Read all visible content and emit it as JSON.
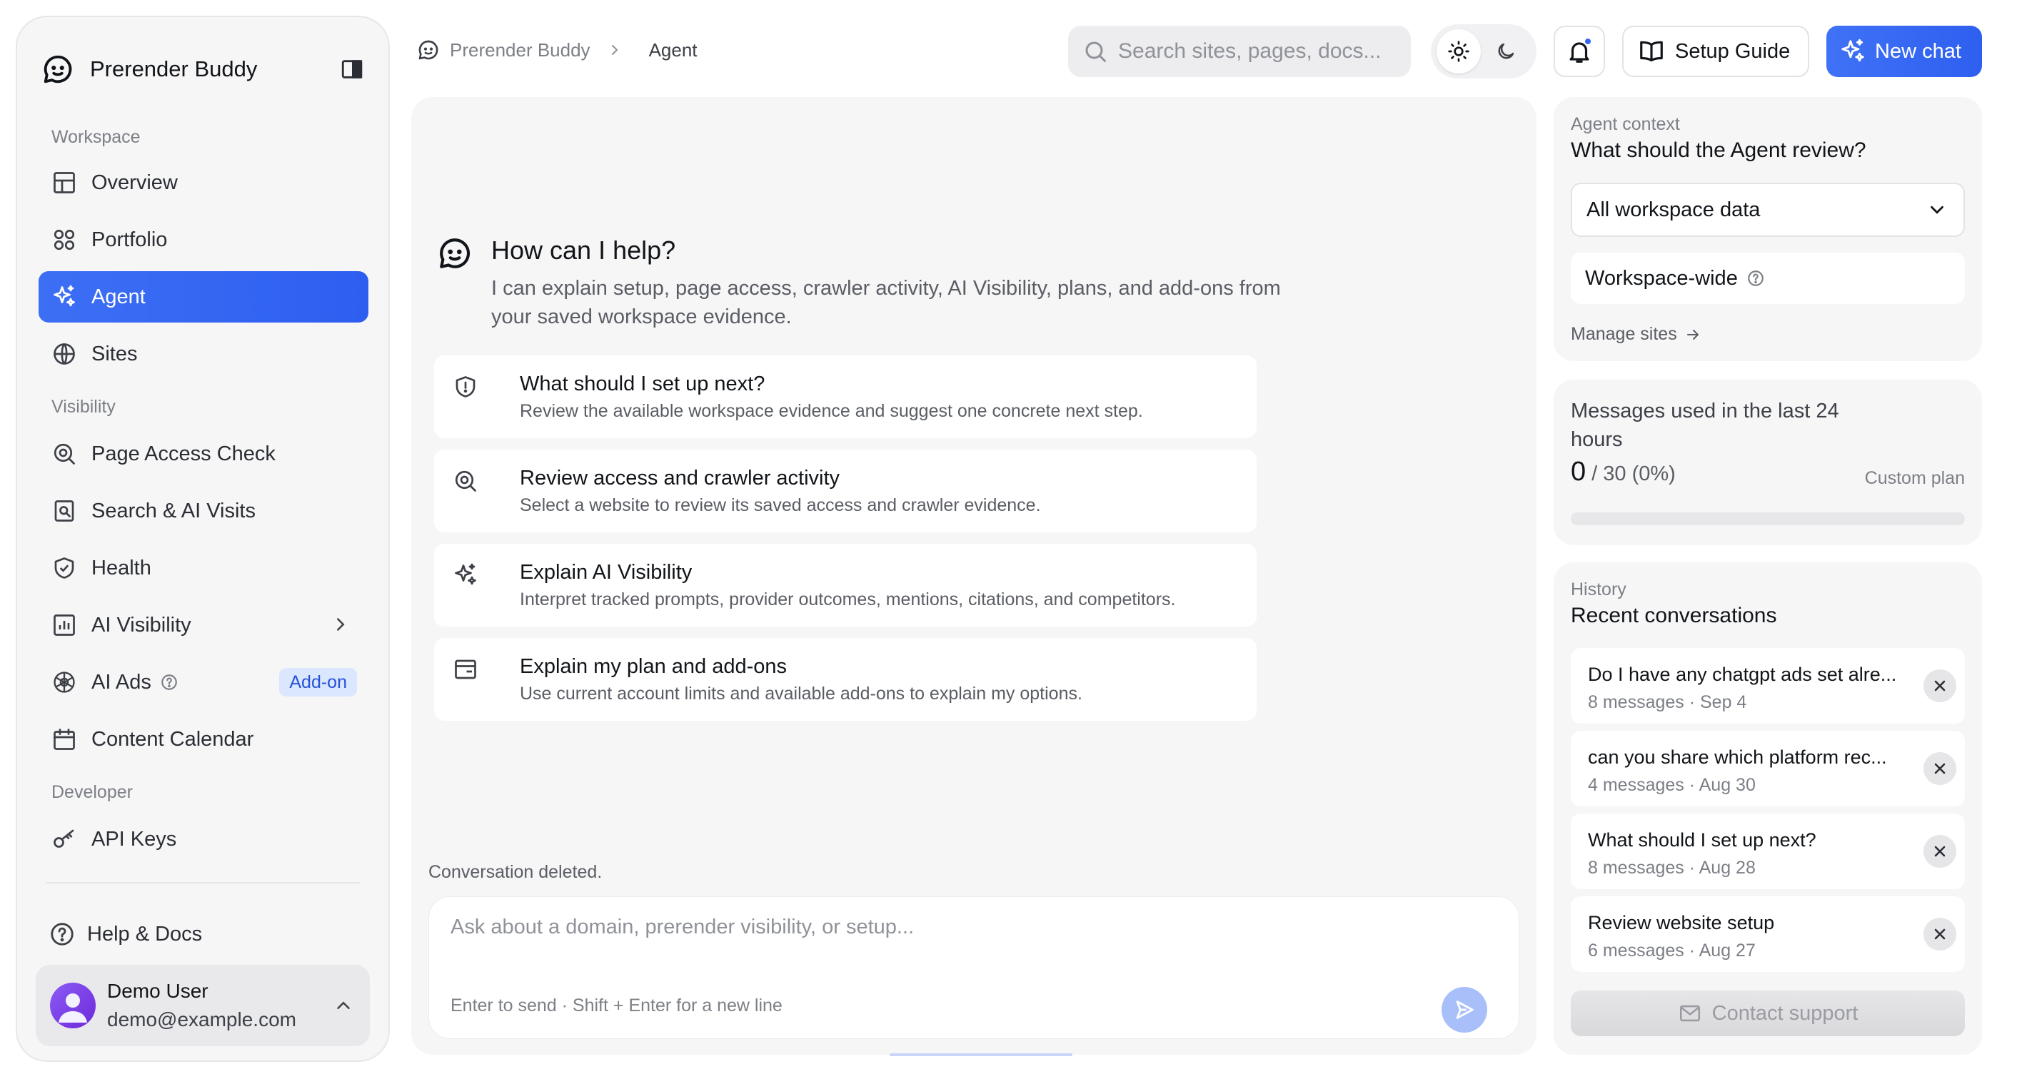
{
  "brand": {
    "name": "Prerender Buddy"
  },
  "sidebar": {
    "sections": {
      "workspace": "Workspace",
      "visibility": "Visibility",
      "developer": "Developer"
    },
    "items": [
      {
        "label": "Overview",
        "icon": "grid-icon"
      },
      {
        "label": "Portfolio",
        "icon": "circles-icon"
      },
      {
        "label": "Agent",
        "icon": "sparkles-icon",
        "active": true
      },
      {
        "label": "Sites",
        "icon": "globe-icon"
      },
      {
        "label": "Page Access Check",
        "icon": "search-scan-icon"
      },
      {
        "label": "Search & AI Visits",
        "icon": "doc-search-icon"
      },
      {
        "label": "Health",
        "icon": "shield-check-icon"
      },
      {
        "label": "AI Visibility",
        "icon": "bar-chart-icon"
      },
      {
        "label": "AI Ads",
        "icon": "openai-icon",
        "badge": "Add-on"
      },
      {
        "label": "Content Calendar",
        "icon": "calendar-icon"
      },
      {
        "label": "API Keys",
        "icon": "key-icon"
      }
    ],
    "help": "Help & Docs",
    "user": {
      "name": "Demo User",
      "email": "demo@example.com"
    }
  },
  "header": {
    "breadcrumb": [
      "Prerender Buddy",
      "Agent"
    ],
    "search_placeholder": "Search sites, pages, docs...",
    "setup_guide": "Setup Guide",
    "new_chat": "New chat"
  },
  "main": {
    "title": "How can I help?",
    "subtitle": "I can explain setup, page access, crawler activity, AI Visibility, plans, and add-ons from your saved workspace evidence.",
    "suggestions": [
      {
        "title": "What should I set up next?",
        "desc": "Review the available workspace evidence and suggest one concrete next step.",
        "icon": "shield-alert-icon"
      },
      {
        "title": "Review access and crawler activity",
        "desc": "Select a website to review its saved access and crawler evidence.",
        "icon": "search-scan-icon"
      },
      {
        "title": "Explain AI Visibility",
        "desc": "Interpret tracked prompts, provider outcomes, mentions, citations, and competitors.",
        "icon": "sparkles-icon"
      },
      {
        "title": "Explain my plan and add-ons",
        "desc": "Use current account limits and available add-ons to explain my options.",
        "icon": "card-icon"
      }
    ],
    "toast": "Conversation deleted.",
    "composer_placeholder": "Ask about a domain, prerender visibility, or setup...",
    "composer_hint": "Enter to send · Shift + Enter for a new line"
  },
  "context": {
    "eyebrow": "Agent context",
    "title": "What should the Agent review?",
    "selected": "All workspace data",
    "scope": "Workspace-wide",
    "manage": "Manage sites"
  },
  "usage": {
    "title": "Messages used in the last 24 hours",
    "used": "0",
    "rest": "/ 30 (0%)",
    "plan": "Custom plan",
    "percent": 0
  },
  "history": {
    "eyebrow": "History",
    "title": "Recent conversations",
    "items": [
      {
        "title": "Do I have any chatgpt ads set alre...",
        "meta": "8 messages · Sep 4"
      },
      {
        "title": "can you share which platform rec...",
        "meta": "4 messages · Aug 30"
      },
      {
        "title": "What should I set up next?",
        "meta": "8 messages · Aug 28"
      },
      {
        "title": "Review website setup",
        "meta": "6 messages · Aug 27"
      }
    ],
    "contact_support": "Contact support"
  },
  "colors": {
    "accent": "#3366f2",
    "badge_bg": "#dbe6ff",
    "badge_text": "#2554d6"
  }
}
